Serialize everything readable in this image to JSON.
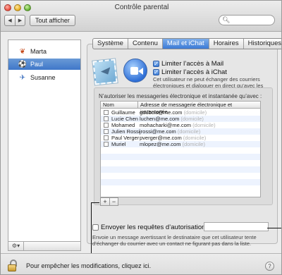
{
  "window": {
    "title": "Contrôle parental"
  },
  "toolbar": {
    "show_all_label": "Tout afficher",
    "back_glyph": "◀",
    "forward_glyph": "▶",
    "search_placeholder": ""
  },
  "sidebar": {
    "users": [
      {
        "name": "Marta",
        "icon": "butterfly-icon",
        "selected": false
      },
      {
        "name": "Paul",
        "icon": "soccer-ball-icon",
        "selected": true
      },
      {
        "name": "Susanne",
        "icon": "airplane-icon",
        "selected": false
      }
    ],
    "gear_glyph": "⚙▾"
  },
  "tabs": [
    {
      "label": "Système",
      "active": false
    },
    {
      "label": "Contenu",
      "active": false
    },
    {
      "label": "Mail et iChat",
      "active": true
    },
    {
      "label": "Horaires",
      "active": false
    },
    {
      "label": "Historiques",
      "active": false
    }
  ],
  "mail_ichat": {
    "limit_mail_label": "Limiter l’accès à Mail",
    "limit_mail_checked": true,
    "limit_ichat_label": "Limiter l’accès à iChat",
    "limit_ichat_checked": true,
    "description": "Cet utilisateur ne peut échanger des courriers électroniques et dialoguer en direct qu’avec les adresses ajoutées à la liste."
  },
  "allowed_list": {
    "caption": "N’autoriser les messageries électronique et instantanée qu’avec :",
    "col_name": "Nom",
    "col_address": "Adresse de messagerie électronique et instantanée",
    "rows": [
      {
        "name": "Guillaume",
        "email": "gdubois@me.com",
        "tag": "(domicile)"
      },
      {
        "name": "Lucie Chen",
        "email": "luchen@me.com",
        "tag": "(domicile)"
      },
      {
        "name": "Mohamed",
        "email": "mohacharki@me.com",
        "tag": "(domicile)"
      },
      {
        "name": "Julien Rossi",
        "email": "jrossi@me.com",
        "tag": "(domicile)"
      },
      {
        "name": "Paul Verger",
        "email": "pverger@me.com",
        "tag": "(domicile)"
      },
      {
        "name": "Muriel",
        "email": "mlopez@me.com",
        "tag": "(domicile)"
      }
    ],
    "add_glyph": "+",
    "remove_glyph": "−"
  },
  "send_requests": {
    "label": "Envoyer les requêtes d’autorisation à :",
    "checked": false,
    "field_value": "",
    "description": "Envoie un message avertissant le destinataire que cet utilisateur tente d’échanger du courrier avec un contact ne figurant pas dans la liste."
  },
  "footer": {
    "lock_text": "Pour empêcher les modifications, cliquez ici.",
    "help_glyph": "?"
  }
}
